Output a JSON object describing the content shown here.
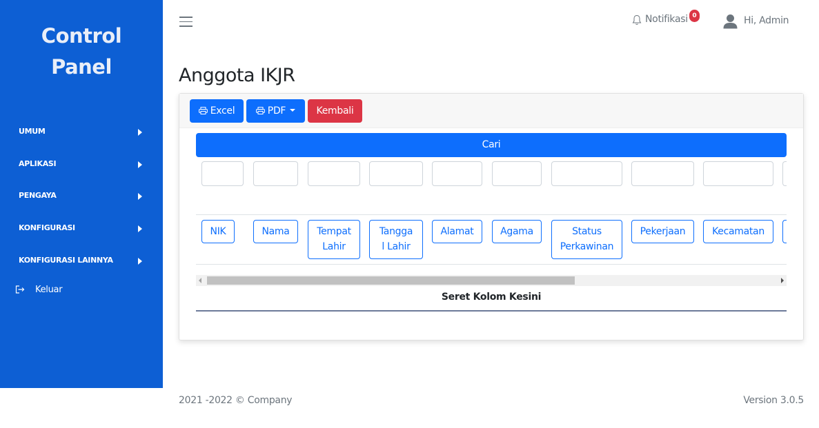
{
  "sidebar": {
    "brand_line1": "Control",
    "brand_line2": "Panel",
    "items": [
      {
        "label": "UMUM"
      },
      {
        "label": "APLIKASI"
      },
      {
        "label": "PENGAYA"
      },
      {
        "label": "KONFIGURASI"
      },
      {
        "label": "KONFIGURASI LAINNYA"
      }
    ],
    "logout_label": "Keluar",
    "background": "#0d5fd4"
  },
  "topbar": {
    "menu_icon": "hamburger-icon",
    "notification_label": "Notifikasi",
    "notification_count": "0",
    "user_label": "Hi, Admin"
  },
  "page": {
    "title": "Anggota IKJR"
  },
  "toolbar": {
    "excel_label": "Excel",
    "pdf_label": "PDF",
    "back_label": "Kembali"
  },
  "search": {
    "button_label": "Cari"
  },
  "columns": [
    {
      "line1": "NIK",
      "line2": ""
    },
    {
      "line1": "Nama",
      "line2": ""
    },
    {
      "line1": "Tempat",
      "line2": "Lahir"
    },
    {
      "line1": "Tangga",
      "line2": "l Lahir"
    },
    {
      "line1": "Alamat",
      "line2": ""
    },
    {
      "line1": "Agama",
      "line2": ""
    },
    {
      "line1": "Status",
      "line2": "Perkawinan"
    },
    {
      "line1": "Pekerjaan",
      "line2": ""
    },
    {
      "line1": "Kecamatan",
      "line2": ""
    }
  ],
  "drop_zone": {
    "label": "Seret Kolom Kesini"
  },
  "footer": {
    "copyright": "2021 -2022 © Company",
    "version": "Version 3.0.5"
  },
  "colors": {
    "primary": "#0d6efd",
    "danger": "#dc3545",
    "sidebar": "#0d5fd4"
  }
}
